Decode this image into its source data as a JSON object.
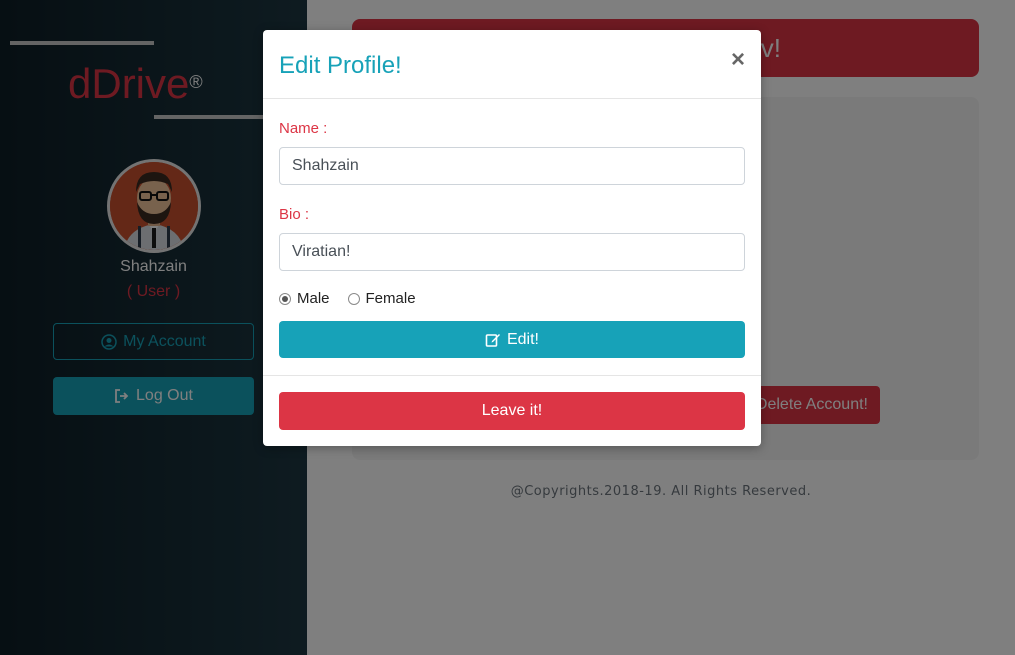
{
  "sidebar": {
    "brand": "dDrive",
    "brand_mark": "®",
    "username": "Shahzain",
    "role": "( User )",
    "account_button": "My Account",
    "account_icon": "user-circle-icon",
    "logout_button": "Log Out",
    "logout_icon": "sign-out-icon"
  },
  "main": {
    "banner_text": "v!",
    "delete_button": "Delete Account!",
    "copyright": "@Copyrights.2018-19. All Rights Reserved."
  },
  "modal": {
    "title": "Edit Profile!",
    "close_symbol": "×",
    "name_label": "Name :",
    "name_value": "Shahzain",
    "bio_label": "Bio :",
    "bio_value": "Viratian!",
    "gender_options": [
      "Male",
      "Female"
    ],
    "gender_selected": "Male",
    "edit_button": "Edit!",
    "edit_icon": "edit-icon",
    "leave_button": "Leave it!"
  },
  "colors": {
    "accent": "#17a2b8",
    "danger": "#dc3545",
    "sidebar_dark": "#0d1e26"
  }
}
